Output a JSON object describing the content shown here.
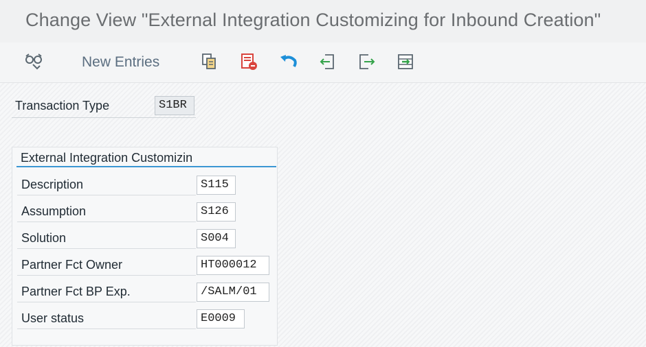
{
  "header": {
    "title": "Change View \"External Integration Customizing for Inbound Creation\""
  },
  "toolbar": {
    "new_entries_label": "New Entries",
    "icons": [
      "display-change-glasses-icon",
      "copy-icon",
      "delete-icon",
      "undo-icon",
      "previous-entry-icon",
      "next-entry-icon",
      "select-block-icon"
    ]
  },
  "transaction": {
    "label": "Transaction Type",
    "value": "S1BR"
  },
  "panel": {
    "title": "External Integration Customizin",
    "rows": [
      {
        "label": "Description",
        "value": "S115"
      },
      {
        "label": "Assumption",
        "value": "S126"
      },
      {
        "label": "Solution",
        "value": "S004"
      },
      {
        "label": "Partner Fct Owner",
        "value": "HT000012"
      },
      {
        "label": "Partner Fct BP Exp.",
        "value": "/SALM/01"
      },
      {
        "label": "User status",
        "value": "E0009"
      }
    ]
  },
  "colors": {
    "accent_rule": "#3b97d3",
    "delete_red": "#d9443d",
    "undo_blue": "#1d8fd8",
    "nav_green": "#34a34a"
  }
}
